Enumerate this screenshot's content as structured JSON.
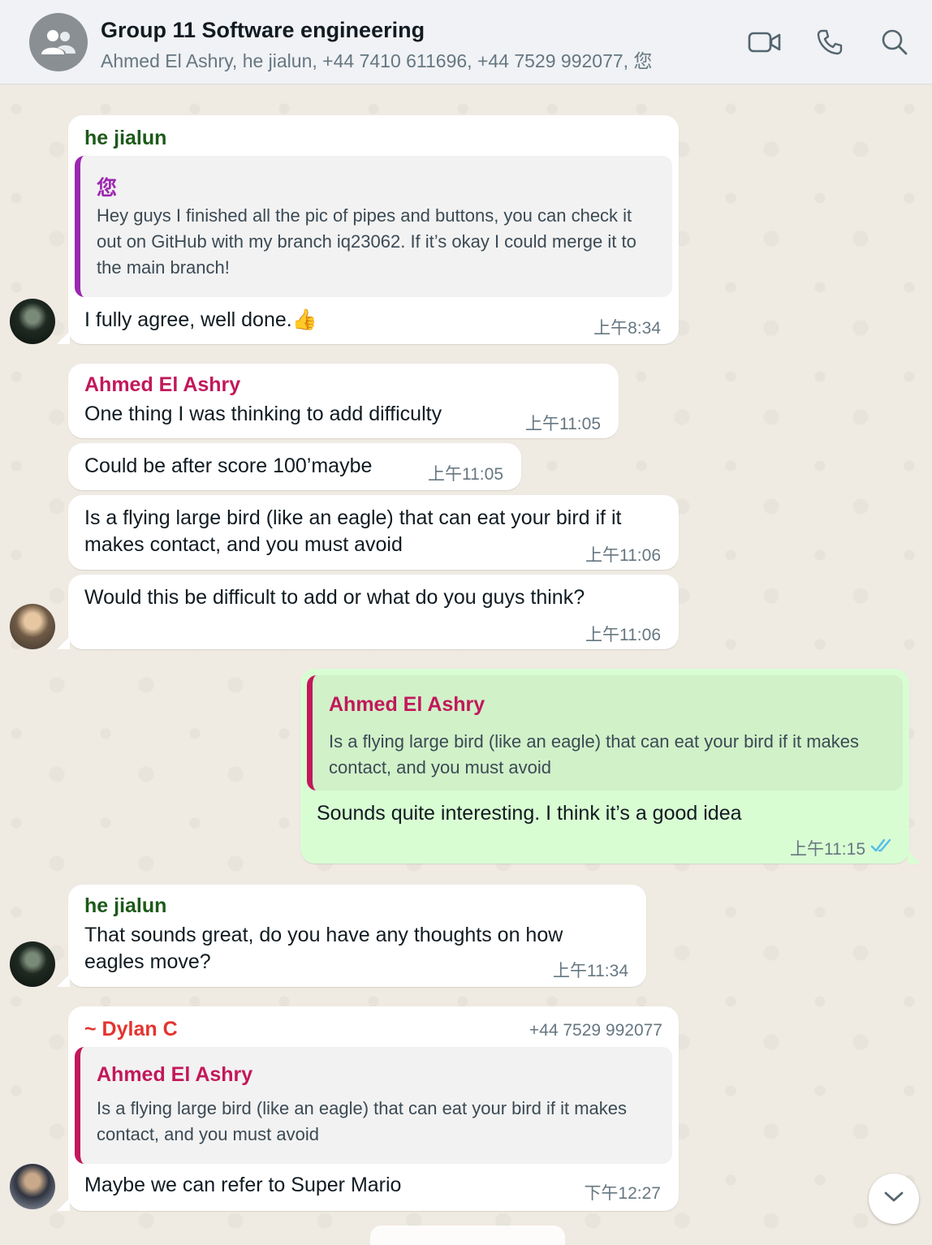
{
  "header": {
    "title": "Group 11 Software engineering",
    "members": "Ahmed El Ashry, he jialun, +44 7410 611696, +44 7529 992077, 您",
    "icons": [
      "group-avatar-icon",
      "video-call-icon",
      "voice-call-icon",
      "search-icon"
    ]
  },
  "messages": [
    {
      "sender": "he jialun",
      "quote_sender": "您",
      "quote_text": "Hey guys I finished all the pic of pipes and buttons, you can check it out on GitHub with my branch iq23062. If it’s okay I could merge it to the main branch!",
      "text": "I fully agree, well done.👍",
      "time": "上午8:34"
    },
    {
      "sender": "Ahmed El Ashry",
      "text": "One thing I was thinking to add difficulty",
      "time": "上午11:05"
    },
    {
      "text": "Could be after score 100’maybe",
      "time": "上午11:05"
    },
    {
      "text": "Is a flying large bird (like an eagle) that can eat your bird if it makes contact, and you must avoid",
      "time": "上午11:06"
    },
    {
      "text": "Would this be difficult to add or what do you guys think?",
      "time": "上午11:06"
    },
    {
      "outgoing": true,
      "quote_sender": "Ahmed El Ashry",
      "quote_text": "Is a flying large bird (like an eagle) that can eat your bird if it makes contact, and you must avoid",
      "text": "Sounds quite interesting. I think it’s a good idea",
      "time": "上午11:15",
      "status": "read-double-check"
    },
    {
      "sender": "he jialun",
      "text": "That sounds great, do you have any thoughts on how eagles move?",
      "time": "上午11:34"
    },
    {
      "sender": "~ Dylan C",
      "phone": "+44 7529 992077",
      "quote_sender": "Ahmed El Ashry",
      "quote_text": "Is a flying large bird (like an eagle) that can eat your bird if it makes contact, and you must avoid",
      "text": "Maybe we can refer to Super Mario",
      "time": "下午12:27"
    }
  ],
  "colors": {
    "header_bg": "#f0f2f5",
    "chat_bg": "#efeae2",
    "incoming_bubble": "#ffffff",
    "outgoing_bubble": "#d9fdd3",
    "sender_he_jialun": "#1d5a1a",
    "sender_ahmed": "#c2185b",
    "sender_dylan": "#e3342f",
    "quote_you": "#9c27b0",
    "read_ticks": "#53bdeb"
  },
  "controls": {
    "scroll_down": "chevron-down-icon"
  }
}
